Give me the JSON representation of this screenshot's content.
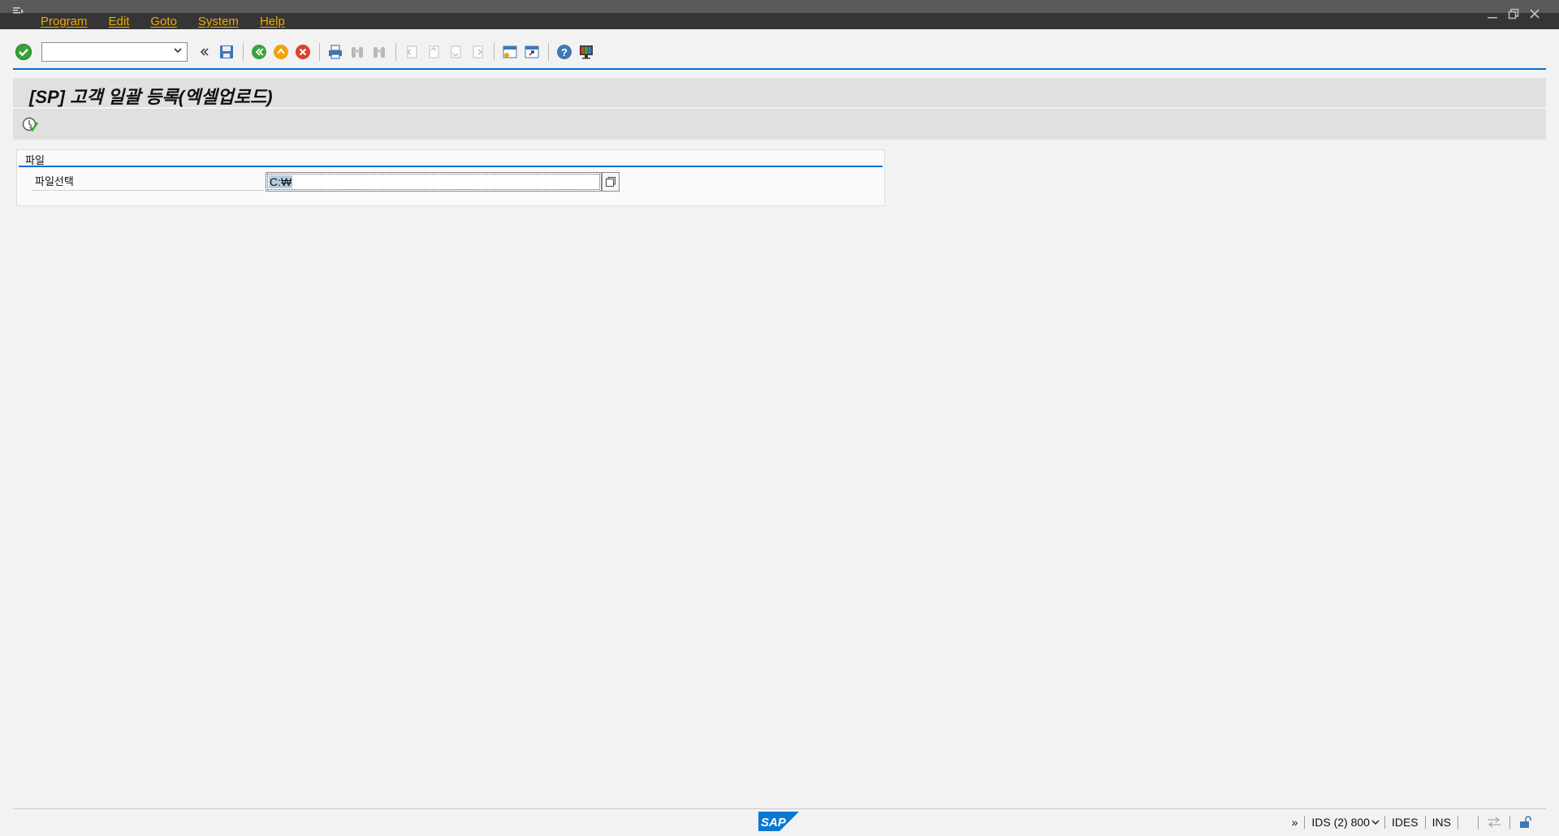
{
  "menubar": {
    "items": [
      {
        "label": "Program"
      },
      {
        "label": "Edit"
      },
      {
        "label": "Goto"
      },
      {
        "label": "System"
      },
      {
        "label": "Help"
      }
    ]
  },
  "toolbar": {
    "command_field": {
      "value": ""
    }
  },
  "page": {
    "title": "[SP] 고객 일괄 등록(엑셀업로드)"
  },
  "group": {
    "title": "파일",
    "field_label": "파일선택",
    "field_value": "C:₩"
  },
  "statusbar": {
    "expand": "»",
    "system": "IDS (2) 800",
    "server": "IDES",
    "mode": "INS"
  },
  "colors": {
    "accent": "#0a6ed1",
    "menu_text": "#f0ab00",
    "menubar_bg": "#353535",
    "title_bg": "#e0e0e0",
    "body_bg": "#f2f2f2"
  }
}
